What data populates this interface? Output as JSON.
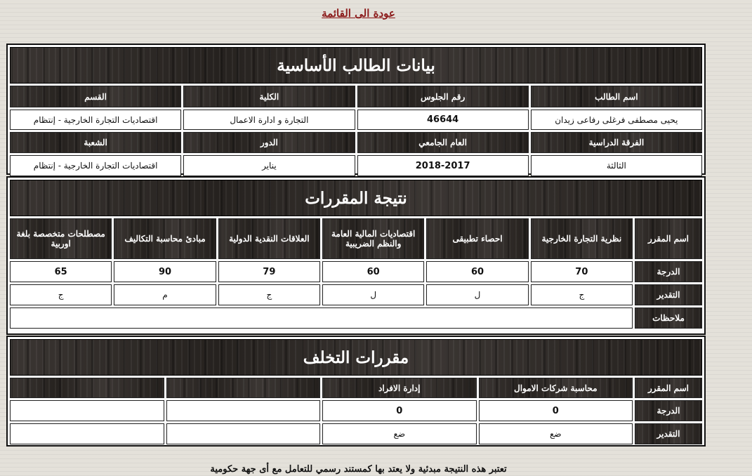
{
  "nav": {
    "back_label": "عودة الى القائمة"
  },
  "student": {
    "title": "بيانات الطالب الأساسية",
    "headers_row1": [
      "اسم الطالب",
      "رقم الجلوس",
      "الكلية",
      "القسم"
    ],
    "values_row1": [
      "يحيى مصطفى فرغلى رفاعى زيدان",
      "46644",
      "التجارة و ادارة الاعمال",
      "اقتصاديات التجارة الخارجية - إنتظام"
    ],
    "headers_row2": [
      "الفرقة الدراسية",
      "العام الجامعي",
      "الدور",
      "الشعبة"
    ],
    "values_row2": [
      "الثالثة",
      "2018-2017",
      "يناير",
      "اقتصاديات التجارة الخارجية - إنتظام"
    ]
  },
  "results": {
    "title": "نتيجة المقررات",
    "course_label": "اسم المقرر",
    "grade_label": "الدرجة",
    "rating_label": "التقدير",
    "notes_label": "ملاحظات",
    "notes_value": "",
    "courses": [
      {
        "name": "نظرية التجارة الخارجية",
        "grade": "70",
        "rating": "ج"
      },
      {
        "name": "احصاء تطبيقى",
        "grade": "60",
        "rating": "ل"
      },
      {
        "name": "اقتصاديات المالية العامة والنظم الضريبية",
        "grade": "60",
        "rating": "ل"
      },
      {
        "name": "العلاقات النقدية الدولية",
        "grade": "79",
        "rating": "ج"
      },
      {
        "name": "مبادئ محاسبة التكاليف",
        "grade": "90",
        "rating": "م"
      },
      {
        "name": "مصطلحات متخصصة بلغة اوربية",
        "grade": "65",
        "rating": "ج"
      }
    ]
  },
  "failed": {
    "title": "مقررات التخلف",
    "course_label": "اسم المقرر",
    "grade_label": "الدرجة",
    "rating_label": "التقدير",
    "courses": [
      {
        "name": "محاسبة شركات الاموال",
        "grade": "0",
        "rating": "ضع"
      },
      {
        "name": "إدارة الافراد",
        "grade": "0",
        "rating": "ضع"
      },
      {
        "name": "",
        "grade": "",
        "rating": ""
      },
      {
        "name": "",
        "grade": "",
        "rating": ""
      }
    ]
  },
  "footer": {
    "note": "تعتبر هذه النتيجة مبدئية ولا يعتد بها كمستند رسمي للتعامل مع أى جهة حكومية"
  }
}
